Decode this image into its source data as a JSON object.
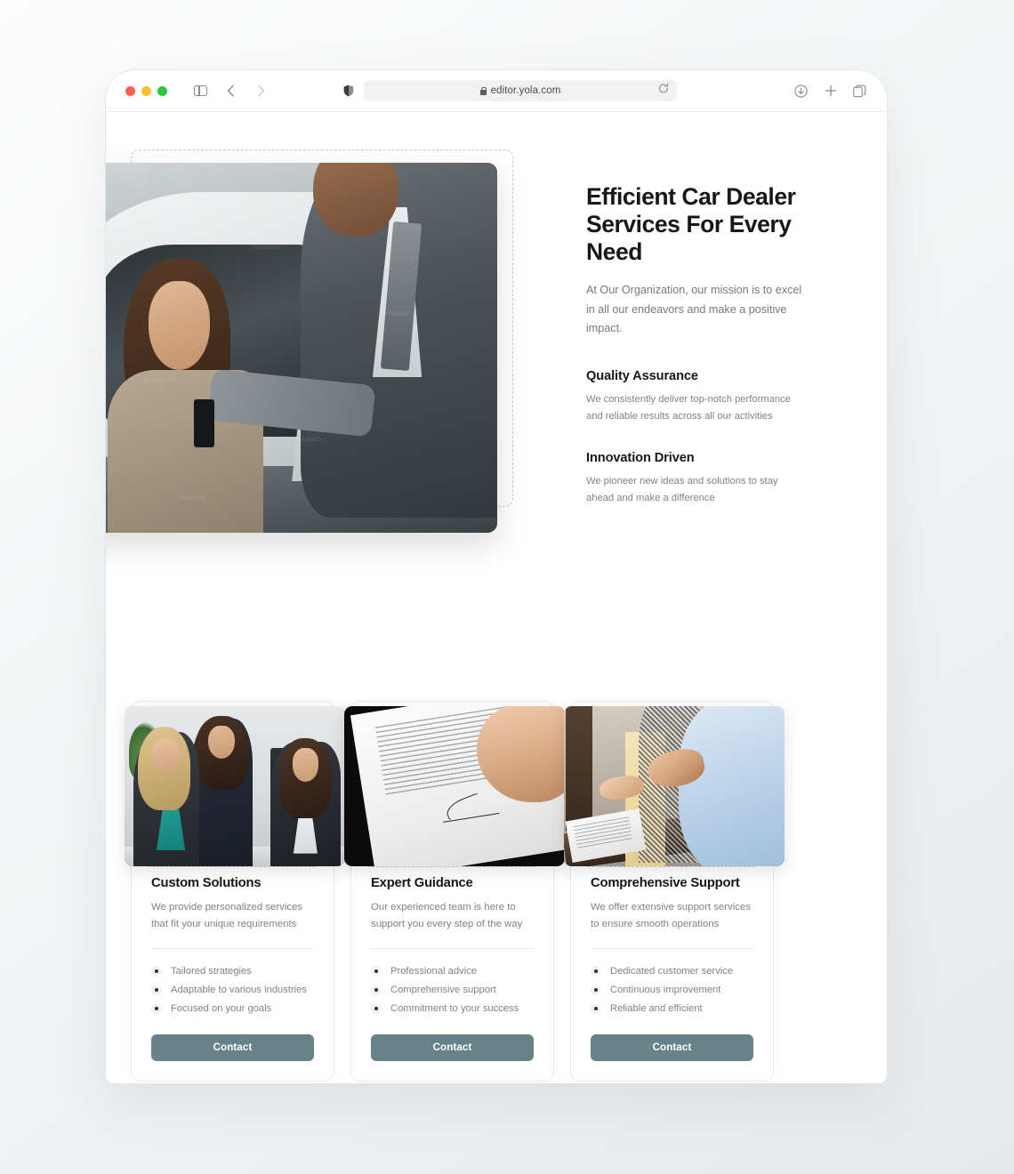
{
  "browser": {
    "url": "editor.yola.com",
    "lock_icon": "lock-icon",
    "reload_icon": "reload-icon",
    "sidebar_icon": "sidebar-toggle-icon",
    "back_icon": "chevron-left-icon",
    "forward_icon": "chevron-right-icon",
    "shield_icon": "privacy-shield-icon",
    "download_icon": "download-icon",
    "newtab_icon": "plus-icon",
    "tabs_icon": "tab-overview-icon"
  },
  "hero": {
    "title": "Efficient Car Dealer Services For Every Need",
    "subtitle": "At Our Organization, our mission is to excel in all our endeavors and make a positive impact.",
    "image_alt": "car-dealer-handing-keys-photo",
    "watermarks": [
      "Unsplash",
      "Unsplash",
      "Unsplash",
      "Unsplash",
      "Unsplash",
      "Unsplash"
    ],
    "features": [
      {
        "title": "Quality Assurance",
        "text": "We consistently deliver top-notch performance and reliable results across all our activities"
      },
      {
        "title": "Innovation Driven",
        "text": "We pioneer new ideas and solutions to stay ahead and make a difference"
      }
    ]
  },
  "cards": [
    {
      "title": "Custom Solutions",
      "description": "We provide personalized services that fit your unique requirements",
      "image_alt": "business-women-meeting-photo",
      "bullets": [
        "Tailored strategies",
        "Adaptable to various industries",
        "Focused on your goals"
      ],
      "button_label": "Contact"
    },
    {
      "title": "Expert Guidance",
      "description": "Our experienced team is here to support you every step of the way",
      "image_alt": "hand-signing-document-photo",
      "bullets": [
        "Professional advice",
        "Comprehensive support",
        "Commitment to your success"
      ],
      "button_label": "Contact"
    },
    {
      "title": "Comprehensive Support",
      "description": "We offer extensive support services to ensure smooth operations",
      "image_alt": "handshake-over-clipboard-photo",
      "bullets": [
        "Dedicated customer service",
        "Continuous improvement",
        "Reliable and efficient"
      ],
      "button_label": "Contact"
    }
  ],
  "colors": {
    "accent_button": "#678289",
    "heading": "#16181c",
    "body_text": "#7d838a",
    "selection_dash": "#c8cccf",
    "card_border": "#e8eaec"
  }
}
